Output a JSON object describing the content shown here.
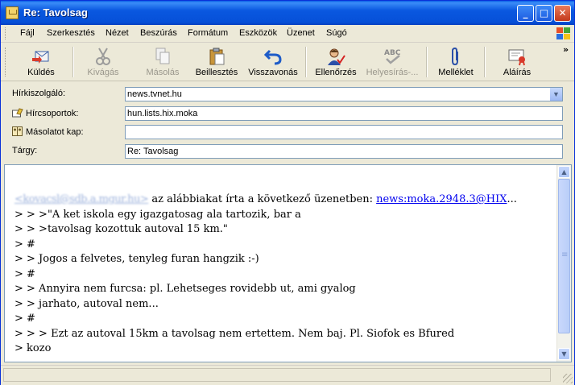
{
  "window": {
    "title": "Re: Tavolsag"
  },
  "menu": [
    "Fájl",
    "Szerkesztés",
    "Nézet",
    "Beszúrás",
    "Formátum",
    "Eszközök",
    "Üzenet",
    "Súgó"
  ],
  "toolbar": {
    "send": "Küldés",
    "cut": "Kivágás",
    "copy": "Másolás",
    "paste": "Beillesztés",
    "undo": "Visszavonás",
    "check": "Ellenőrzés",
    "spell": "Helyesírás-...",
    "attach": "Melléklet",
    "sign": "Aláírás"
  },
  "header": {
    "server_label": "Hírkiszolgáló:",
    "server_value": "news.tvnet.hu",
    "groups_label": "Hírcsoportok:",
    "groups_value": "hun.lists.hix.moka",
    "cc_label": "Másolatot kap:",
    "cc_value": "",
    "subject_label": "Tárgy:",
    "subject_value": "Re: Tavolsag"
  },
  "message": {
    "sender_blurred": "<kovacsl@sdb.a.mgur.hu>",
    "intro": " az alábbiakat írta a következő üzenetben: ",
    "link": "news:moka.2948.3@HIX",
    "ellipsis": "...",
    "lines": [
      "> > >\"A ket iskola egy igazgatosag ala tartozik, bar a",
      "> > >tavolsag kozottuk autoval 15 km.\"",
      "> #",
      "> > Jogos a felvetes, tenyleg furan hangzik :-)",
      "> #",
      "> > Annyira nem furcsa: pl. Lehetseges rovidebb ut, ami gyalog",
      "> > jarhato, autoval nem...",
      "> #",
      "> > > Ezt az autoval 15km a tavolsag nem ertettem. Nem baj. Pl. Siofok es Bfured",
      "> kozo"
    ]
  },
  "colors": {
    "titlebar": "#0a58e0",
    "link": "#0000ee",
    "chrome": "#ece9d8"
  }
}
